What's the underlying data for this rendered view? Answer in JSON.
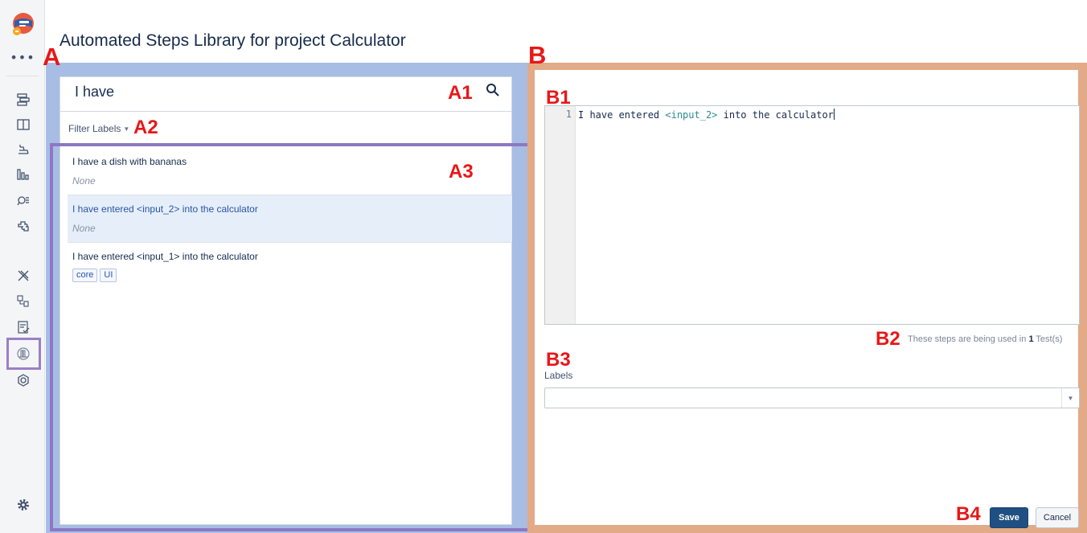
{
  "app": {
    "page_title": "Automated Steps Library for project Calculator",
    "more_glyph": "•••",
    "nav_icons": [
      "backlog-icon",
      "board-icon",
      "releases-icon",
      "reports-icon",
      "issues-search-icon",
      "components-icon",
      "xray-icon",
      "test-repository-icon",
      "test-plan-icon",
      "steps-library-icon",
      "add-ons-icon",
      "settings-icon"
    ]
  },
  "annotations": {
    "a": "A",
    "a1": "A1",
    "a2": "A2",
    "a3": "A3",
    "b": "B",
    "b1": "B1",
    "b2": "B2",
    "b3": "B3",
    "b4": "B4"
  },
  "search": {
    "value": "I have"
  },
  "filter": {
    "label": "Filter Labels"
  },
  "steps_list": [
    {
      "text": "I have a dish with bananas",
      "labels_text": "None",
      "labels": [],
      "selected": false
    },
    {
      "text": "I have entered <input_2> into the calculator",
      "labels_text": "None",
      "labels": [],
      "selected": true
    },
    {
      "text": "I have entered <input_1> into the calculator",
      "labels_text": "",
      "labels": [
        "core",
        "UI"
      ],
      "selected": false
    }
  ],
  "editor": {
    "line_number": "1",
    "code_before": "I have entered ",
    "code_var": "<input_2>",
    "code_after": " into the calculator"
  },
  "usage": {
    "prefix": "These steps are being used in ",
    "count": "1",
    "suffix": " Test(s)"
  },
  "labels_field": {
    "caption": "Labels",
    "value": ""
  },
  "buttons": {
    "save": "Save",
    "cancel": "Cancel"
  },
  "colors": {
    "annotation": "#e81717",
    "panel_a": "#a7bde4",
    "list_box": "#8d78c4",
    "panel_b": "#e2aa86",
    "save_button": "#205081",
    "selected_row": "#e6eef9"
  }
}
